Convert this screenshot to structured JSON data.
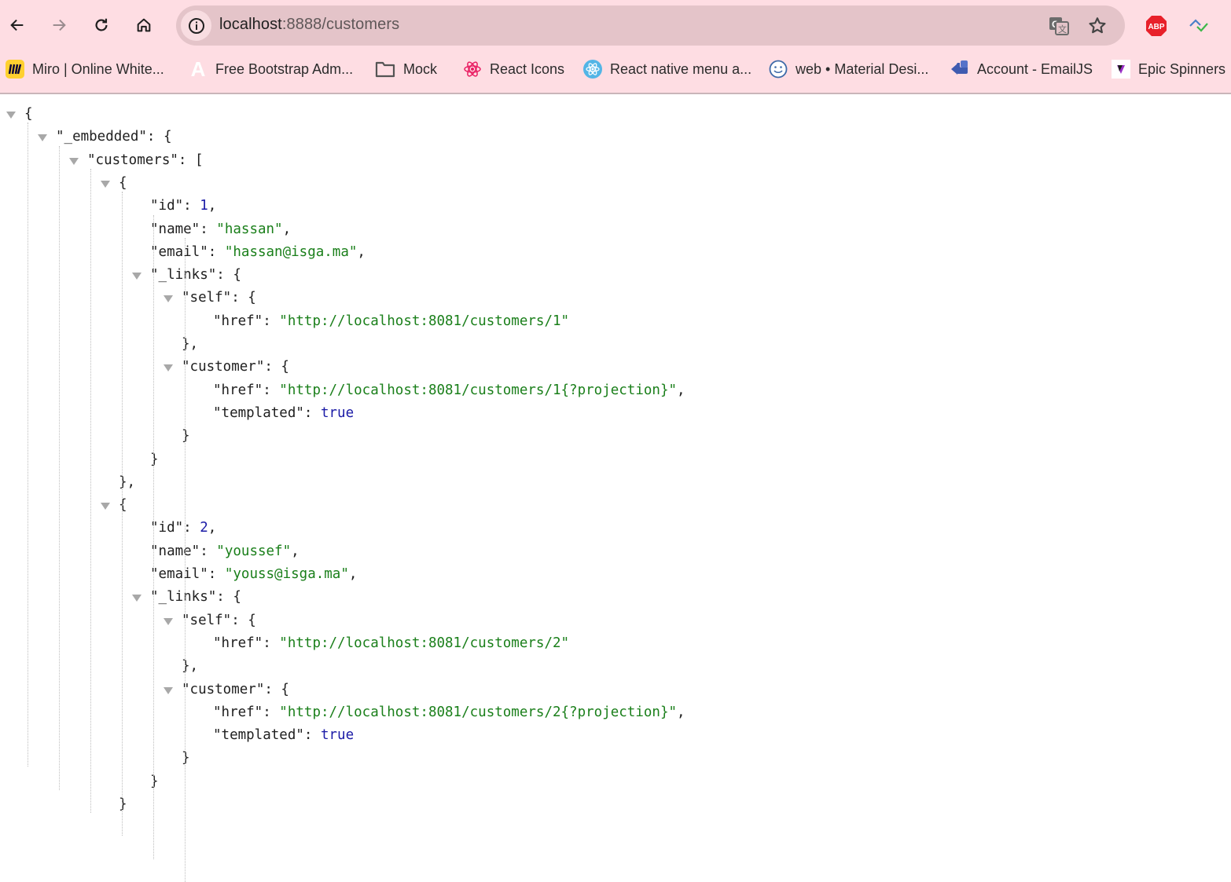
{
  "browser": {
    "url_host": "localhost",
    "url_port_path": ":8888/customers",
    "nav": {
      "back": "back-arrow-icon",
      "forward": "forward-arrow-icon",
      "reload": "reload-icon",
      "home": "home-icon"
    },
    "omnibox_icons": [
      "site-info-icon",
      "translate-icon",
      "bookmark-star-icon"
    ],
    "extensions": [
      "adblock-plus-icon",
      "extension-wave-icon"
    ],
    "abp_label": "ABP"
  },
  "bookmarks": [
    {
      "label": "Miro | Online White...",
      "icon": "miro-icon"
    },
    {
      "label": "Free Bootstrap Adm...",
      "icon": "bootstrap-admin-icon"
    },
    {
      "label": "Mock",
      "icon": "folder-icon"
    },
    {
      "label": "React Icons",
      "icon": "react-icons-icon"
    },
    {
      "label": "React native menu a...",
      "icon": "react-native-icon"
    },
    {
      "label": "web • Material Desi...",
      "icon": "smiley-icon"
    },
    {
      "label": "Account - EmailJS",
      "icon": "emailjs-icon"
    },
    {
      "label": "Epic Spinners",
      "icon": "epic-spinners-icon"
    }
  ],
  "json": {
    "root_key": "_embedded",
    "list_key": "customers",
    "customers": [
      {
        "id": "1",
        "name": "\"hassan\"",
        "email": "\"hassan@isga.ma\"",
        "self_href": "\"http://localhost:8081/customers/1\"",
        "customer_href": "\"http://localhost:8081/customers/1{?projection}\"",
        "templated": "true"
      },
      {
        "id": "2",
        "name": "\"youssef\"",
        "email": "\"youss@isga.ma\"",
        "self_href": "\"http://localhost:8081/customers/2\"",
        "customer_href": "\"http://localhost:8081/customers/2{?projection}\"",
        "templated": "true"
      }
    ],
    "keys": {
      "id": "\"id\"",
      "name": "\"name\"",
      "email": "\"email\"",
      "links": "\"_links\"",
      "self": "\"self\"",
      "customer": "\"customer\"",
      "href": "\"href\"",
      "templated": "\"templated\"",
      "embedded": "\"_embedded\"",
      "customers": "\"customers\""
    }
  }
}
